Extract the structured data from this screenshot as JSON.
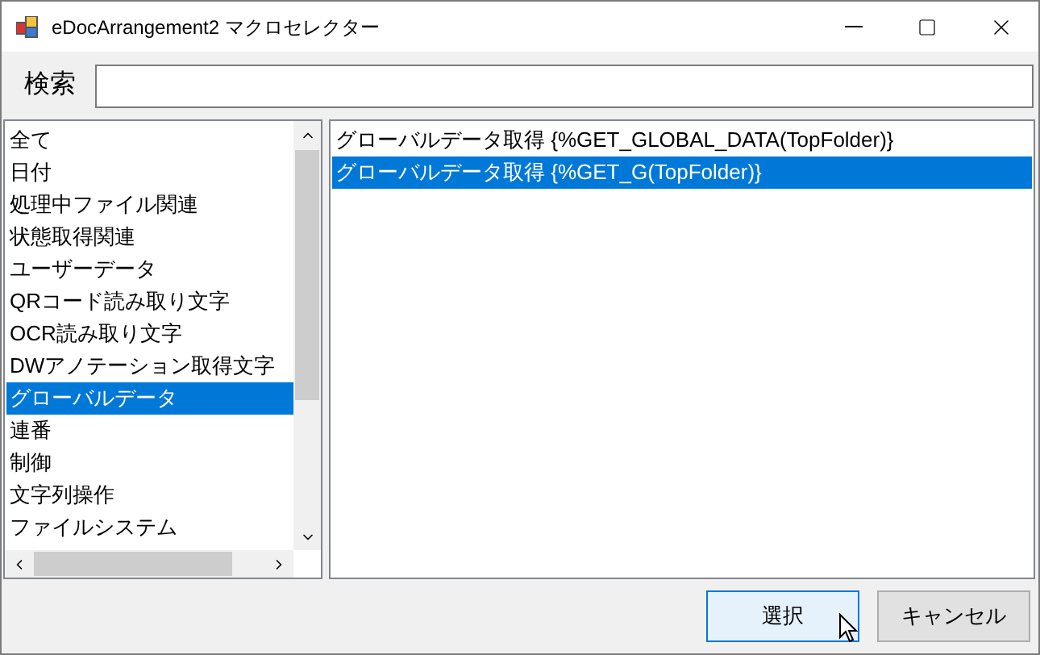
{
  "window": {
    "title": "eDocArrangement2 マクロセレクター"
  },
  "search": {
    "label": "検索"
  },
  "categories": [
    {
      "label": "全て",
      "selected": false
    },
    {
      "label": "日付",
      "selected": false
    },
    {
      "label": "処理中ファイル関連",
      "selected": false
    },
    {
      "label": "状態取得関連",
      "selected": false
    },
    {
      "label": "ユーザーデータ",
      "selected": false
    },
    {
      "label": "QRコード読み取り文字",
      "selected": false
    },
    {
      "label": "OCR読み取り文字",
      "selected": false
    },
    {
      "label": "DWアノテーション取得文字",
      "selected": false
    },
    {
      "label": "グローバルデータ",
      "selected": true
    },
    {
      "label": "連番",
      "selected": false
    },
    {
      "label": "制御",
      "selected": false
    },
    {
      "label": "文字列操作",
      "selected": false
    },
    {
      "label": "ファイルシステム",
      "selected": false
    }
  ],
  "macros": [
    {
      "label": "グローバルデータ取得 {%GET_GLOBAL_DATA(TopFolder)}",
      "selected": false
    },
    {
      "label": "グローバルデータ取得 {%GET_G(TopFolder)}",
      "selected": true
    }
  ],
  "buttons": [
    {
      "label": "選択",
      "selected": true
    },
    {
      "label": "キャンセル",
      "selected": false
    }
  ]
}
